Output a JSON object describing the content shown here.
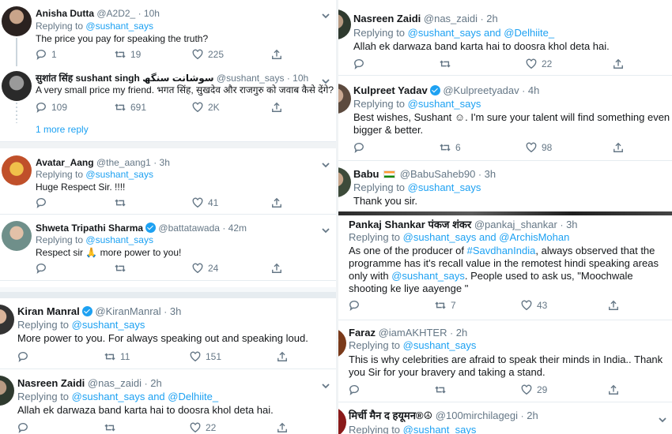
{
  "left": {
    "tweets": [
      {
        "name": "Anisha Dutta",
        "handle": "@A2D2_",
        "time": "10h",
        "replying_label": "Replying to",
        "replying_to": "@sushant_says",
        "text": "The price you pay for speaking the truth?",
        "replies": "1",
        "retweets": "19",
        "likes": "225"
      },
      {
        "name": "सुशांत सिंह sushant singh سوشانت سنگھ",
        "handle": "@sushant_says",
        "time": "10h",
        "text": "A very small price my friend. भगत सिंह, सुखदेव और राजगुरु को जवाब कैसे देंगे?",
        "replies": "109",
        "retweets": "691",
        "likes": "2K",
        "more_reply": "1 more reply"
      },
      {
        "name": "Avatar_Aang",
        "handle": "@the_aang1",
        "time": "3h",
        "replying_label": "Replying to",
        "replying_to": "@sushant_says",
        "text": "Huge Respect Sir. !!!!",
        "replies": "",
        "retweets": "",
        "likes": "41"
      },
      {
        "name": "Shweta Tripathi Sharma",
        "handle": "@battatawada",
        "time": "42m",
        "replying_label": "Replying to",
        "replying_to": "@sushant_says",
        "text": "Respect sir 🙏 more power to you!",
        "replies": "",
        "retweets": "",
        "likes": "24"
      },
      {
        "name": "Kiran Manral",
        "handle": "@KiranManral",
        "time": "3h",
        "replying_label": "Replying to",
        "replying_to": "@sushant_says",
        "text": "More power to you. For always speaking out and speaking loud.",
        "replies": "",
        "retweets": "11",
        "likes": "151"
      },
      {
        "name": "Nasreen Zaidi",
        "handle": "@nas_zaidi",
        "time": "2h",
        "replying_label": "Replying to",
        "replying_to": "@sushant_says and @Delhiite_",
        "text": "Allah ek darwaza band karta hai to doosra khol deta hai.",
        "replies": "",
        "retweets": "",
        "likes": "22"
      }
    ]
  },
  "right": {
    "tweets": [
      {
        "name": "Nasreen Zaidi",
        "handle": "@nas_zaidi",
        "time": "2h",
        "replying_label": "Replying to",
        "replying_to": "@sushant_says and @Delhiite_",
        "text": "Allah ek darwaza band karta hai to doosra khol deta hai.",
        "replies": "",
        "retweets": "",
        "likes": "22"
      },
      {
        "name": "Kulpreet Yadav",
        "handle": "@Kulpreetyadav",
        "time": "4h",
        "replying_label": "Replying to",
        "replying_to": "@sushant_says",
        "text": "Best wishes, Sushant ☺. I'm sure your talent will find something even bigger & better.",
        "replies": "",
        "retweets": "6",
        "likes": "98"
      },
      {
        "name": "Babu",
        "handle": "@BabuSaheb90",
        "time": "3h",
        "replying_label": "Replying to",
        "replying_to": "@sushant_says",
        "text": "Thank you sir.",
        "replies": "",
        "retweets": "",
        "likes": ""
      },
      {
        "name": "Pankaj Shankar पंकज शंकर",
        "handle": "@pankaj_shankar",
        "time": "3h",
        "replying_label": "Replying to",
        "replying_to": "@sushant_says and @ArchisMohan",
        "text_parts": [
          "As one of the producer of ",
          "#SavdhanIndia",
          ", always observed that the programme has it's recall value in the remotest hindi speaking areas only with ",
          "@sushant_says",
          ". People used to ask us, \"Moochwale shooting ke liye aayenge \""
        ],
        "replies": "",
        "retweets": "7",
        "likes": "43"
      },
      {
        "name": "Faraz",
        "handle": "@iamAKHTER",
        "time": "2h",
        "replying_label": "Replying to",
        "replying_to": "@sushant_says",
        "text": "This is why celebrities are afraid to speak their minds in India.. Thank you Sir for your bravery and taking a stand.",
        "replies": "",
        "retweets": "",
        "likes": "29"
      },
      {
        "name": "मिर्ची मैन द हयूमन®☮",
        "handle": "@100mirchilagegi",
        "time": "2h",
        "replying_label": "Replying to",
        "replying_to": "@sushant_says",
        "text": "",
        "replies": "",
        "retweets": "",
        "likes": ""
      }
    ]
  },
  "colors": {
    "link": "#1da1f2",
    "meta": "#657786",
    "text": "#14171a",
    "border": "#e6ecf0",
    "verified": "#1da1f2"
  }
}
